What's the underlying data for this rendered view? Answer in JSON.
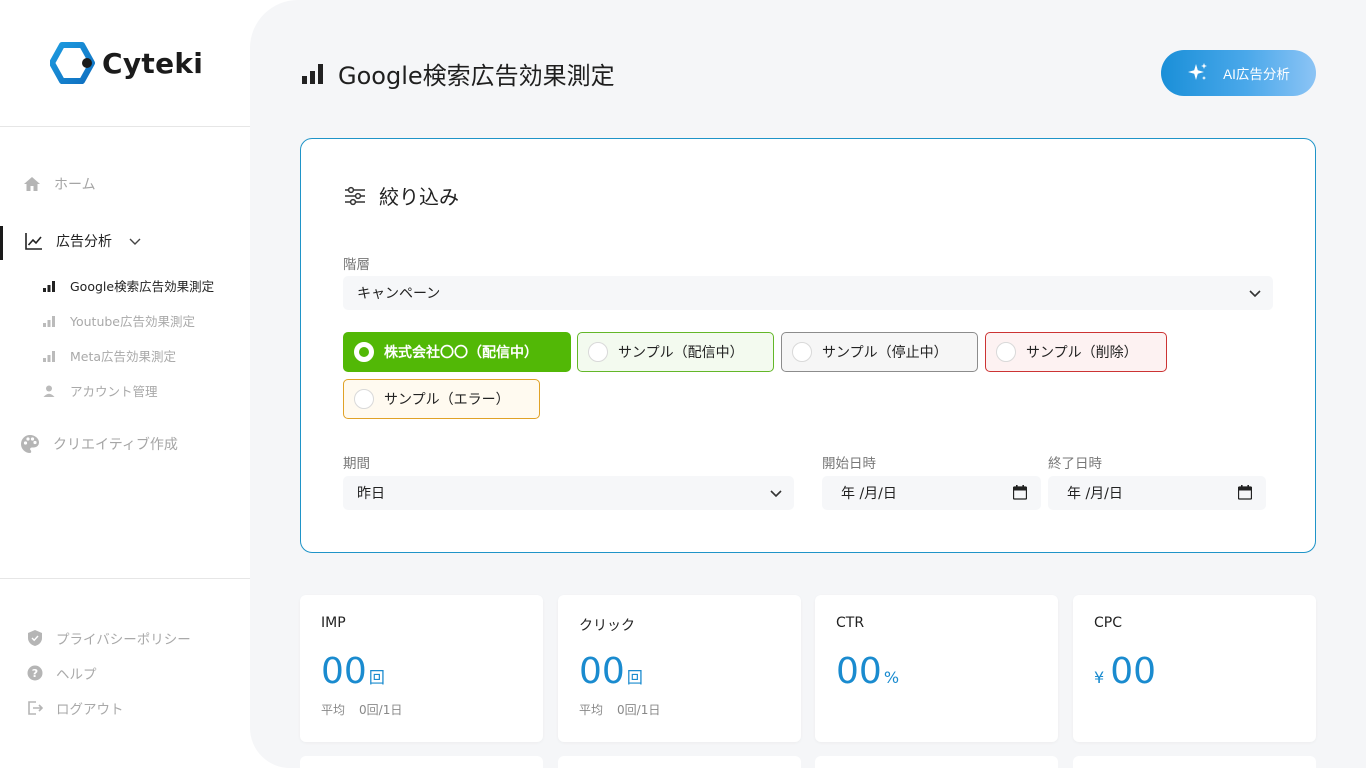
{
  "app": {
    "logo_text": "Cyteki",
    "brand_color": "#1a8bcf"
  },
  "sidebar": {
    "home": "ホーム",
    "ad_analysis": "広告分析",
    "sub_items": [
      {
        "label": "Google検索広告効果測定",
        "icon": "bar-chart-icon"
      },
      {
        "label": "Youtube広告効果測定",
        "icon": "bar-chart-icon"
      },
      {
        "label": "Meta広告効果測定",
        "icon": "bar-chart-icon"
      },
      {
        "label": "アカウント管理",
        "icon": "person-icon"
      }
    ],
    "creative": "クリエイティブ作成",
    "footer": [
      {
        "label": "プライバシーポリシー",
        "icon": "shield-icon"
      },
      {
        "label": "ヘルプ",
        "icon": "help-icon"
      },
      {
        "label": "ログアウト",
        "icon": "logout-icon"
      }
    ]
  },
  "header": {
    "title": "Google検索広告効果測定",
    "ai_button": "AI広告分析"
  },
  "filter": {
    "title": "絞り込み",
    "hierarchy_label": "階層",
    "hierarchy_value": "キャンペーン",
    "campaigns": [
      {
        "label": "株式会社〇〇（配信中）",
        "state": "selected"
      },
      {
        "label": "サンプル（配信中）",
        "state": "active"
      },
      {
        "label": "サンプル（停止中）",
        "state": "stopped"
      },
      {
        "label": "サンプル（削除）",
        "state": "deleted"
      },
      {
        "label": "サンプル（エラー）",
        "state": "error"
      }
    ],
    "period_label": "期間",
    "period_value": "昨日",
    "start_label": "開始日時",
    "start_value": "年 /月/日",
    "end_label": "終了日時",
    "end_value": "年 /月/日"
  },
  "stats": [
    {
      "label": "IMP",
      "prefix": "",
      "value": "00",
      "unit": "回",
      "avg_label": "平均",
      "avg_value": "0回/1日"
    },
    {
      "label": "クリック",
      "prefix": "",
      "value": "00",
      "unit": "回",
      "avg_label": "平均",
      "avg_value": "0回/1日"
    },
    {
      "label": "CTR",
      "prefix": "",
      "value": "00",
      "unit": "%",
      "avg_label": "",
      "avg_value": ""
    },
    {
      "label": "CPC",
      "prefix": "¥",
      "value": "00",
      "unit": "",
      "avg_label": "",
      "avg_value": ""
    }
  ]
}
